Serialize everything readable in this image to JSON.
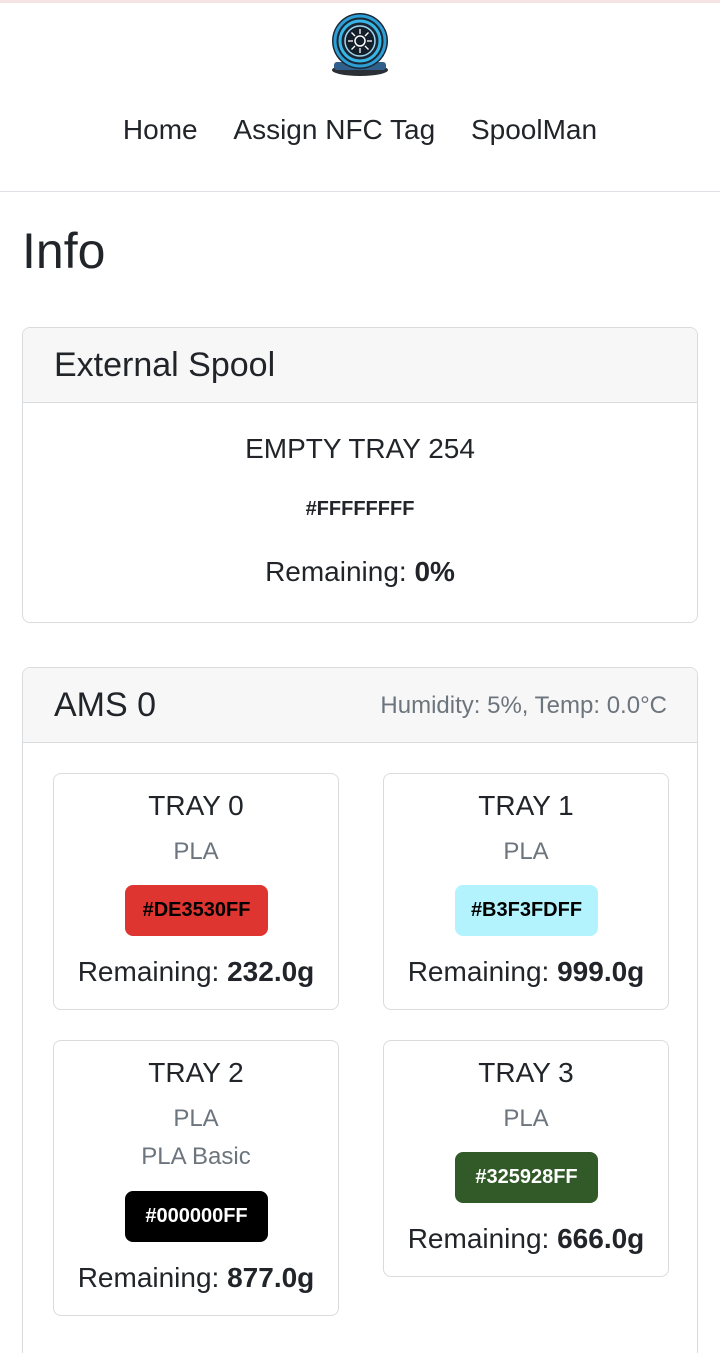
{
  "nav": {
    "logo": "spool-logo",
    "items": [
      {
        "label": "Home"
      },
      {
        "label": "Assign NFC Tag"
      },
      {
        "label": "SpoolMan"
      }
    ]
  },
  "page": {
    "title": "Info"
  },
  "external_spool": {
    "title": "External Spool",
    "name": "EMPTY TRAY 254",
    "color_hex": "#FFFFFFFF",
    "remaining_label": "Remaining: ",
    "remaining_value": "0%"
  },
  "ams": {
    "title": "AMS 0",
    "status": "Humidity: 5%, Temp: 0.0°C",
    "trays": [
      {
        "name": "TRAY 0",
        "type": "PLA",
        "subtype": "",
        "color_hex": "#DE3530FF",
        "badge_bg": "#de3530",
        "badge_fg": "#000000",
        "remaining_label": "Remaining: ",
        "remaining_value": "232.0g"
      },
      {
        "name": "TRAY 1",
        "type": "PLA",
        "subtype": "",
        "color_hex": "#B3F3FDFF",
        "badge_bg": "#b3f3fd",
        "badge_fg": "#000000",
        "remaining_label": "Remaining: ",
        "remaining_value": "999.0g"
      },
      {
        "name": "TRAY 2",
        "type": "PLA",
        "subtype": "PLA Basic",
        "color_hex": "#000000FF",
        "badge_bg": "#000000",
        "badge_fg": "#ffffff",
        "remaining_label": "Remaining: ",
        "remaining_value": "877.0g"
      },
      {
        "name": "TRAY 3",
        "type": "PLA",
        "subtype": "",
        "color_hex": "#325928FF",
        "badge_bg": "#325928",
        "badge_fg": "#ffffff",
        "remaining_label": "Remaining: ",
        "remaining_value": "666.0g"
      }
    ]
  }
}
